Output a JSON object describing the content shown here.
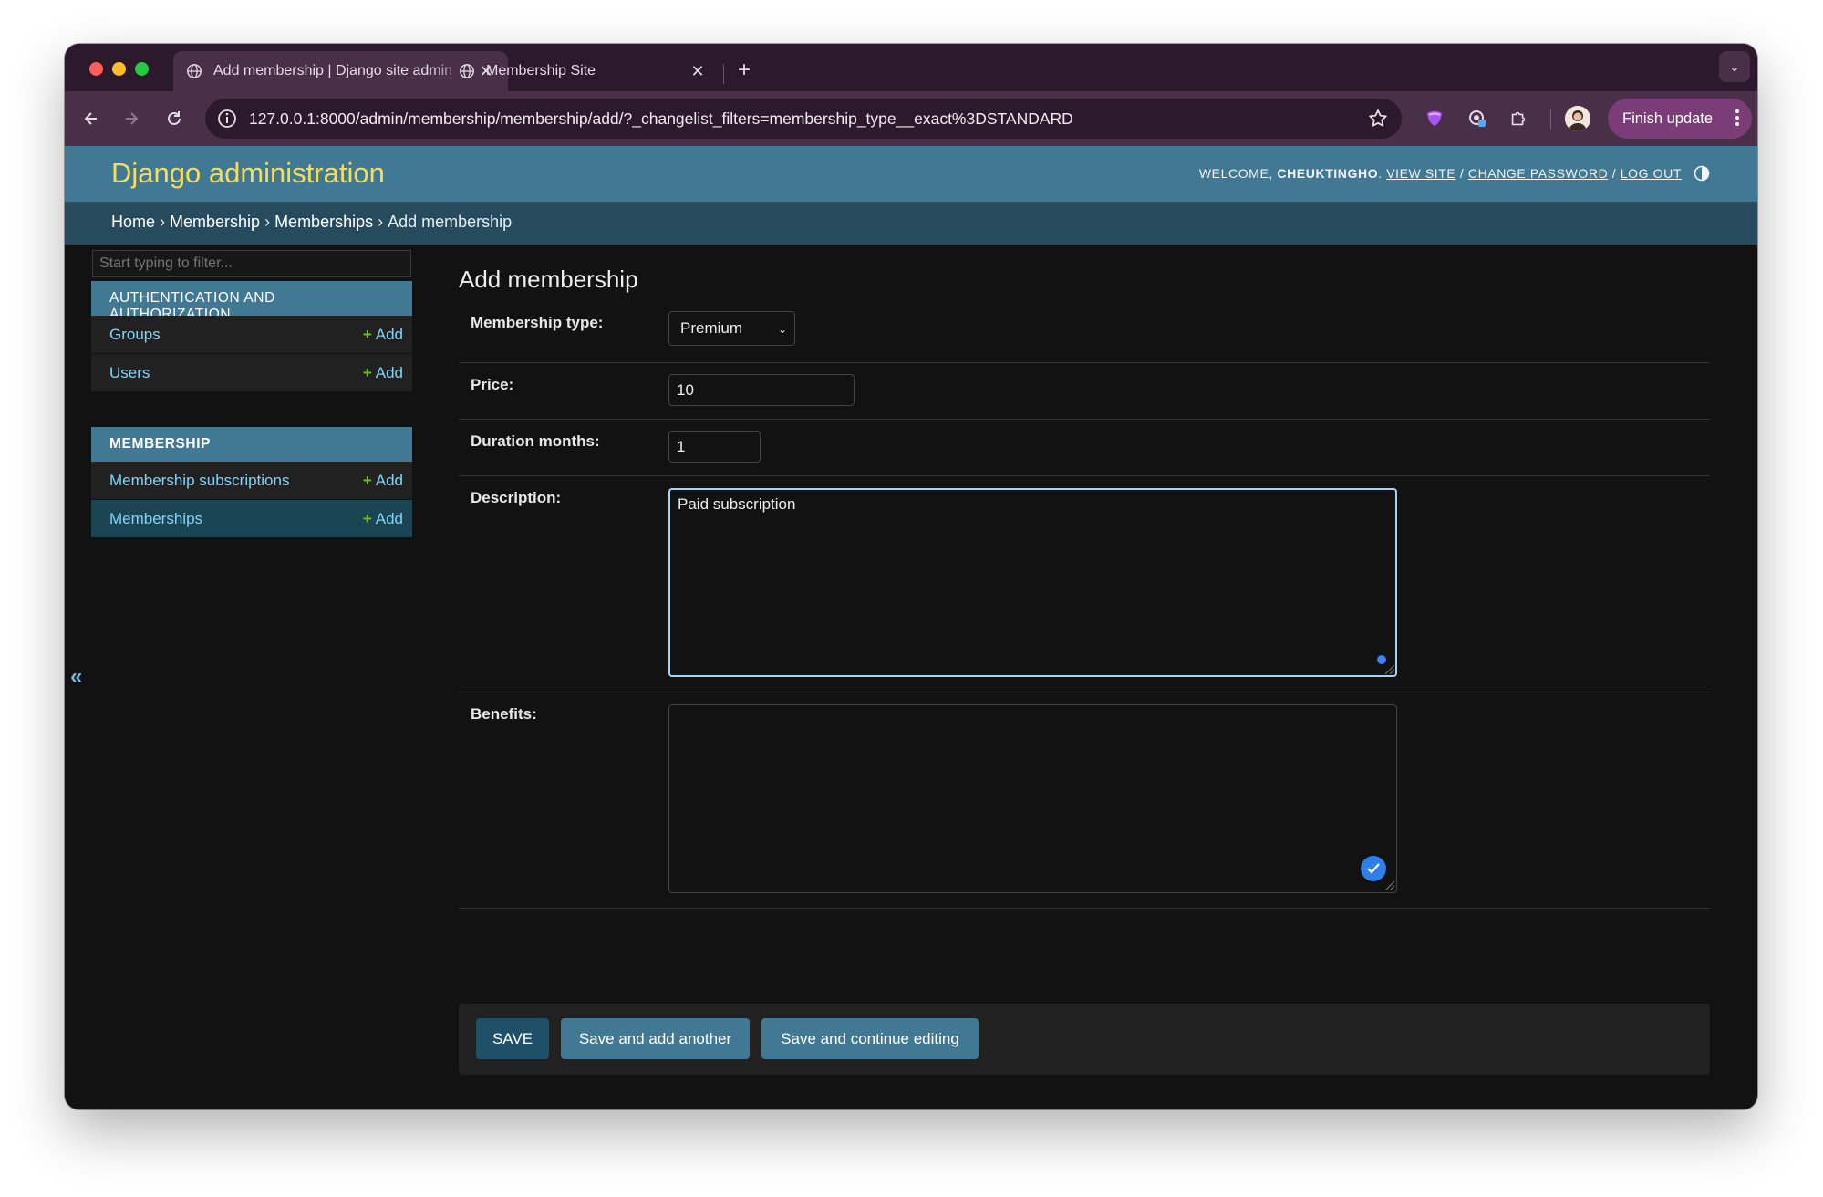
{
  "browser": {
    "tabs": [
      {
        "title": "Add membership | Django site admin",
        "active": true
      },
      {
        "title": "Membership Site",
        "active": false
      }
    ],
    "url": "127.0.0.1:8000/admin/membership/membership/add/?_changelist_filters=membership_type__exact%3DSTANDARD",
    "finish_update_label": "Finish update",
    "accent_color": "#4a2f48"
  },
  "header": {
    "brand": "Django administration",
    "welcome": "Welcome,",
    "username": "cheuktingho",
    "view_site": "View site",
    "change_password": "Change password",
    "log_out": "Log out",
    "header_color": "#417893"
  },
  "breadcrumbs": {
    "home": "Home",
    "app": "Membership",
    "model": "Memberships",
    "current": "Add membership",
    "separator": "›"
  },
  "sidebar": {
    "filter_placeholder": "Start typing to filter...",
    "collapse_label": "«",
    "modules": [
      {
        "name": "Authentication and Authorization",
        "items": [
          {
            "label": "Groups",
            "add_label": "Add"
          },
          {
            "label": "Users",
            "add_label": "Add"
          }
        ]
      },
      {
        "name": "Membership",
        "items": [
          {
            "label": "Membership subscriptions",
            "add_label": "Add"
          },
          {
            "label": "Memberships",
            "add_label": "Add",
            "current": true
          }
        ]
      }
    ]
  },
  "form": {
    "title": "Add membership",
    "membership_type": {
      "label": "Membership type:",
      "value": "Premium"
    },
    "price": {
      "label": "Price:",
      "value": "10"
    },
    "duration_months": {
      "label": "Duration months:",
      "value": "1"
    },
    "description": {
      "label": "Description:",
      "value": "Paid subscription"
    },
    "benefits": {
      "label": "Benefits:",
      "value": ""
    },
    "buttons": {
      "save": "SAVE",
      "save_add_another": "Save and add another",
      "save_continue": "Save and continue editing"
    }
  }
}
